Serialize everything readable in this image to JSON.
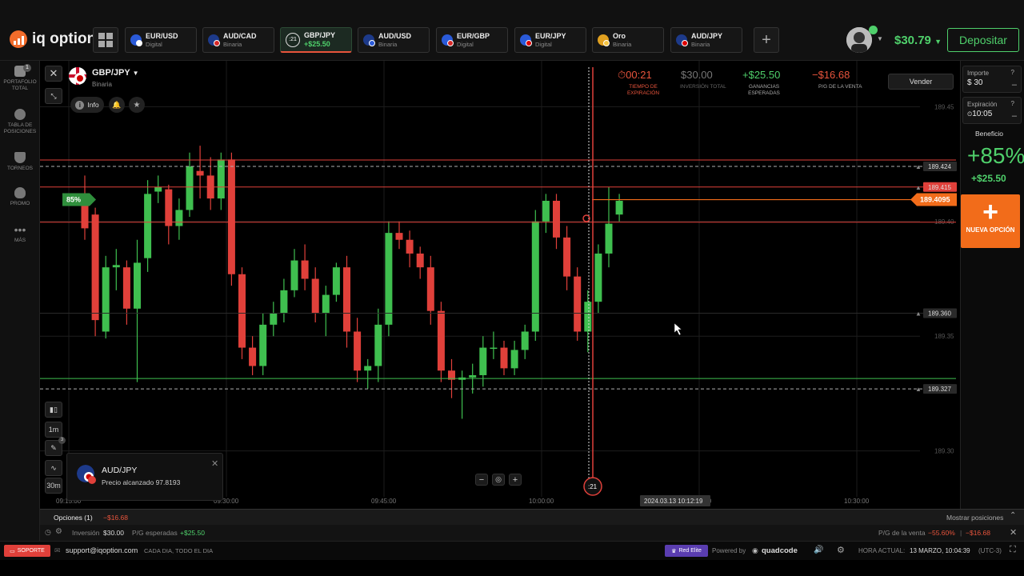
{
  "app": {
    "logo": "iq option"
  },
  "tabs": [
    {
      "pair": "EUR/USD",
      "kind": "Digital",
      "flag": [
        "#2a5ad8",
        "#fff"
      ]
    },
    {
      "pair": "AUD/CAD",
      "kind": "Binaria",
      "flag": [
        "#1d3a8a",
        "#d62828"
      ]
    },
    {
      "pair": "GBP/JPY",
      "kind": "+$25.50",
      "timer": ":21",
      "active": true,
      "flag": [
        "#fff",
        "#d00"
      ]
    },
    {
      "pair": "AUD/USD",
      "kind": "Binaria",
      "flag": [
        "#1d3a8a",
        "#2a5ad8"
      ]
    },
    {
      "pair": "EUR/GBP",
      "kind": "Digital",
      "flag": [
        "#2a5ad8",
        "#d62828"
      ]
    },
    {
      "pair": "EUR/JPY",
      "kind": "Digital",
      "flag": [
        "#2a5ad8",
        "#d00"
      ]
    },
    {
      "pair": "Oro",
      "kind": "Binaria",
      "flag": [
        "#e0a020",
        "#f5c542"
      ]
    },
    {
      "pair": "AUD/JPY",
      "kind": "Binaria",
      "flag": [
        "#1d3a8a",
        "#d00"
      ]
    }
  ],
  "header": {
    "balance": "$30.79",
    "deposit": "Depositar"
  },
  "leftbar": [
    {
      "label": "PORTAFOLIO TOTAL",
      "badge": "1"
    },
    {
      "label": "TABLA DE POSICIONES"
    },
    {
      "label": "TORNEOS"
    },
    {
      "label": "PROMO"
    },
    {
      "label": "MÁS"
    }
  ],
  "asset": {
    "name": "GBP/JPY",
    "kind": "Binaria",
    "info": "Info"
  },
  "trade": {
    "timer": "00:21",
    "timer_label": "TIEMPO DE EXPIRACIÓN",
    "investment": "$30.00",
    "investment_label": "INVERSIÓN TOTAL",
    "profit": "+$25.50",
    "profit_label": "GANANCIAS ESPERADAS",
    "pl": "−$16.68",
    "pl_label": "P/G DE LA VENTA",
    "sell": "Vender"
  },
  "right": {
    "amount_label": "Importe",
    "amount": "$ 30",
    "expiry_label": "Expiración",
    "expiry": "10:05",
    "benefit_label": "Beneficio",
    "benefit_pct": "+85%",
    "benefit_value": "+$25.50",
    "new_option": "NUEVA OPCIÓN"
  },
  "chart_data": {
    "type": "candlestick",
    "ylim": [
      189.28,
      189.47
    ],
    "x_ticks": [
      "09:15:00",
      "09:30:00",
      "09:45:00",
      "10:00:00",
      "10:15:00",
      "10:30:00"
    ],
    "y_ticks": [
      "189.45",
      "189.40",
      "189.35",
      "189.30"
    ],
    "levels": [
      {
        "value": 189.424,
        "label": "189.424",
        "style": "dash-red"
      },
      {
        "value": 189.415,
        "label": "189.415",
        "style": "red"
      },
      {
        "value": 189.36,
        "label": "189.360",
        "style": "grey"
      },
      {
        "value": 189.327,
        "label": "189.327",
        "style": "dash-green"
      }
    ],
    "current_price": "189.4095",
    "payout_tag": "85%",
    "time_label": "2024.03.13 10:12:19",
    "countdown": ":21",
    "candles": [
      {
        "o": 189.41,
        "c": 189.397,
        "h": 189.42,
        "l": 189.392
      },
      {
        "o": 189.403,
        "c": 189.357,
        "h": 189.406,
        "l": 189.35
      },
      {
        "o": 189.352,
        "c": 189.38,
        "h": 189.385,
        "l": 189.349
      },
      {
        "o": 189.38,
        "c": 189.381,
        "h": 189.388,
        "l": 189.37
      },
      {
        "o": 189.38,
        "c": 189.362,
        "h": 189.383,
        "l": 189.355
      },
      {
        "o": 189.362,
        "c": 189.382,
        "h": 189.392,
        "l": 189.33
      },
      {
        "o": 189.384,
        "c": 189.412,
        "h": 189.418,
        "l": 189.378
      },
      {
        "o": 189.413,
        "c": 189.415,
        "h": 189.42,
        "l": 189.408
      },
      {
        "o": 189.414,
        "c": 189.398,
        "h": 189.416,
        "l": 189.39
      },
      {
        "o": 189.398,
        "c": 189.405,
        "h": 189.41,
        "l": 189.392
      },
      {
        "o": 189.405,
        "c": 189.424,
        "h": 189.43,
        "l": 189.402
      },
      {
        "o": 189.422,
        "c": 189.42,
        "h": 189.433,
        "l": 189.41
      },
      {
        "o": 189.42,
        "c": 189.41,
        "h": 189.428,
        "l": 189.405
      },
      {
        "o": 189.41,
        "c": 189.427,
        "h": 189.43,
        "l": 189.405
      },
      {
        "o": 189.427,
        "c": 189.377,
        "h": 189.43,
        "l": 189.372
      },
      {
        "o": 189.377,
        "c": 189.345,
        "h": 189.38,
        "l": 189.34
      },
      {
        "o": 189.345,
        "c": 189.337,
        "h": 189.35,
        "l": 189.333
      },
      {
        "o": 189.337,
        "c": 189.355,
        "h": 189.36,
        "l": 189.333
      },
      {
        "o": 189.355,
        "c": 189.36,
        "h": 189.365,
        "l": 189.35
      },
      {
        "o": 189.36,
        "c": 189.37,
        "h": 189.375,
        "l": 189.356
      },
      {
        "o": 189.37,
        "c": 189.383,
        "h": 189.388,
        "l": 189.367
      },
      {
        "o": 189.383,
        "c": 189.375,
        "h": 189.39,
        "l": 189.37
      },
      {
        "o": 189.375,
        "c": 189.36,
        "h": 189.38,
        "l": 189.356
      },
      {
        "o": 189.36,
        "c": 189.368,
        "h": 189.372,
        "l": 189.35
      },
      {
        "o": 189.368,
        "c": 189.38,
        "h": 189.382,
        "l": 189.365
      },
      {
        "o": 189.38,
        "c": 189.352,
        "h": 189.385,
        "l": 189.345
      },
      {
        "o": 189.352,
        "c": 189.335,
        "h": 189.358,
        "l": 189.33
      },
      {
        "o": 189.335,
        "c": 189.337,
        "h": 189.34,
        "l": 189.327
      },
      {
        "o": 189.337,
        "c": 189.355,
        "h": 189.362,
        "l": 189.33
      },
      {
        "o": 189.355,
        "c": 189.395,
        "h": 189.4,
        "l": 189.35
      },
      {
        "o": 189.395,
        "c": 189.392,
        "h": 189.4,
        "l": 189.388
      },
      {
        "o": 189.392,
        "c": 189.386,
        "h": 189.396,
        "l": 189.38
      },
      {
        "o": 189.386,
        "c": 189.38,
        "h": 189.389,
        "l": 189.375
      },
      {
        "o": 189.38,
        "c": 189.361,
        "h": 189.385,
        "l": 189.355
      },
      {
        "o": 189.361,
        "c": 189.335,
        "h": 189.365,
        "l": 189.33
      },
      {
        "o": 189.335,
        "c": 189.331,
        "h": 189.34,
        "l": 189.323
      },
      {
        "o": 189.331,
        "c": 189.332,
        "h": 189.335,
        "l": 189.314
      },
      {
        "o": 189.332,
        "c": 189.333,
        "h": 189.338,
        "l": 189.325
      },
      {
        "o": 189.333,
        "c": 189.345,
        "h": 189.35,
        "l": 189.328
      },
      {
        "o": 189.345,
        "c": 189.345,
        "h": 189.352,
        "l": 189.34
      },
      {
        "o": 189.345,
        "c": 189.336,
        "h": 189.348,
        "l": 189.333
      },
      {
        "o": 189.336,
        "c": 189.344,
        "h": 189.348,
        "l": 189.333
      },
      {
        "o": 189.344,
        "c": 189.352,
        "h": 189.355,
        "l": 189.34
      },
      {
        "o": 189.352,
        "c": 189.4,
        "h": 189.405,
        "l": 189.348
      },
      {
        "o": 189.4,
        "c": 189.409,
        "h": 189.412,
        "l": 189.395
      },
      {
        "o": 189.409,
        "c": 189.393,
        "h": 189.412,
        "l": 189.388
      },
      {
        "o": 189.393,
        "c": 189.376,
        "h": 189.398,
        "l": 189.37
      },
      {
        "o": 189.376,
        "c": 189.352,
        "h": 189.38,
        "l": 189.348
      },
      {
        "o": 189.352,
        "c": 189.365,
        "h": 189.37,
        "l": 189.343
      },
      {
        "o": 189.365,
        "c": 189.386,
        "h": 189.39,
        "l": 189.36
      },
      {
        "o": 189.386,
        "c": 189.399,
        "h": 189.415,
        "l": 189.38
      },
      {
        "o": 189.403,
        "c": 189.409,
        "h": 189.412,
        "l": 189.4
      }
    ]
  },
  "notification": {
    "pair": "AUD/JPY",
    "text": "Precio alcanzado 97.8193"
  },
  "tools": {
    "interval": "1m",
    "period": "30m",
    "drawings": "3"
  },
  "bottom": {
    "options_label": "Opciones (1)",
    "options_pl": "−$16.68",
    "show_positions": "Mostrar posiciones",
    "investment_label": "Inversión",
    "investment": "$30.00",
    "expected_label": "P/G esperadas",
    "expected": "+$25.50",
    "sale_label": "P/G de la venta",
    "sale_pct": "−55.60%",
    "sale_value": "−$16.68"
  },
  "status": {
    "support": "SOPORTE",
    "email": "support@iqoption.com",
    "hours": "CADA DIA, TODO EL DIA",
    "red_elite": "Red Elite",
    "powered": "Powered by",
    "quadcode": "quadcode",
    "time_label": "HORA ACTUAL:",
    "time": "13 MARZO, 10:04:39",
    "tz": "(UTC-3)"
  },
  "colors": {
    "up": "#3fbf4f",
    "down": "#e0403a",
    "accent": "#f26c1a",
    "green": "#4fd06b"
  }
}
